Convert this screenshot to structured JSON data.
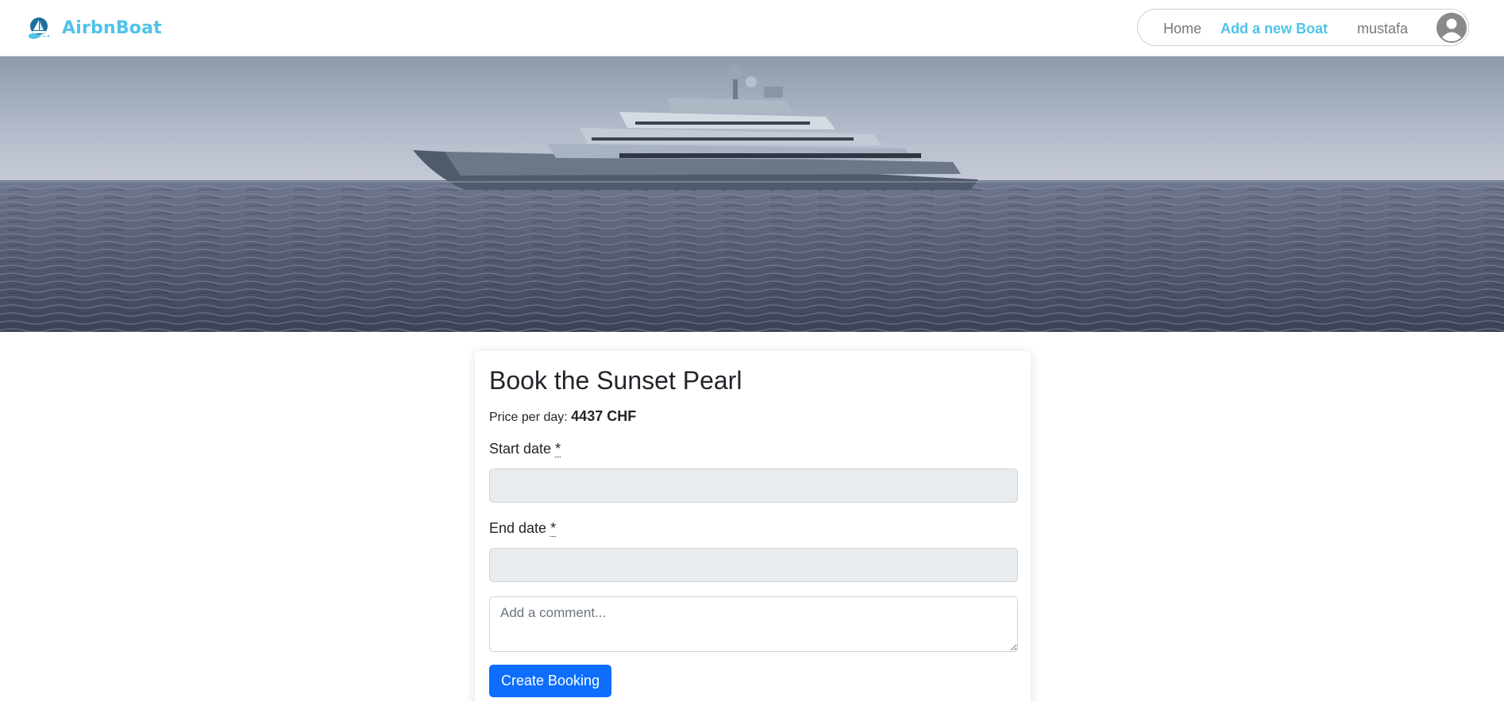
{
  "navbar": {
    "brand": "AirbnBoat",
    "links": {
      "home": "Home",
      "add_boat": "Add a new Boat",
      "user": "mustafa"
    }
  },
  "hero": {
    "icon": "yacht-photo"
  },
  "booking": {
    "title": "Book the Sunset Pearl",
    "price_label": "Price per day:",
    "price_value": "4437 CHF",
    "start_label": "Start date",
    "end_label": "End date",
    "required_marker": "*",
    "comment_placeholder": "Add a comment...",
    "submit_label": "Create Booking"
  },
  "colors": {
    "brand": "#4fc3e8",
    "primary_button": "#0d6efd",
    "input_disabled_bg": "#e9ecef"
  }
}
